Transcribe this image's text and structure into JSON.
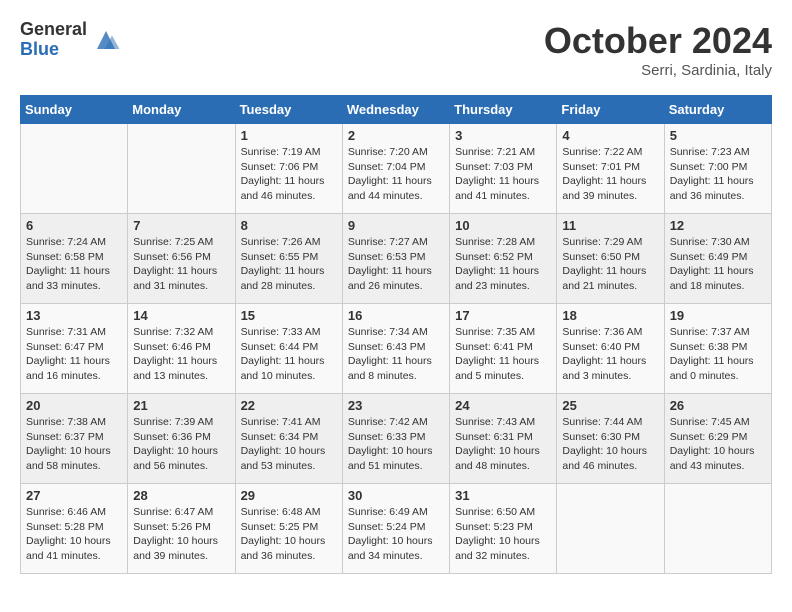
{
  "header": {
    "logo_general": "General",
    "logo_blue": "Blue",
    "month_title": "October 2024",
    "subtitle": "Serri, Sardinia, Italy"
  },
  "days_of_week": [
    "Sunday",
    "Monday",
    "Tuesday",
    "Wednesday",
    "Thursday",
    "Friday",
    "Saturday"
  ],
  "weeks": [
    [
      {
        "day": "",
        "info": ""
      },
      {
        "day": "",
        "info": ""
      },
      {
        "day": "1",
        "info": "Sunrise: 7:19 AM\nSunset: 7:06 PM\nDaylight: 11 hours and 46 minutes."
      },
      {
        "day": "2",
        "info": "Sunrise: 7:20 AM\nSunset: 7:04 PM\nDaylight: 11 hours and 44 minutes."
      },
      {
        "day": "3",
        "info": "Sunrise: 7:21 AM\nSunset: 7:03 PM\nDaylight: 11 hours and 41 minutes."
      },
      {
        "day": "4",
        "info": "Sunrise: 7:22 AM\nSunset: 7:01 PM\nDaylight: 11 hours and 39 minutes."
      },
      {
        "day": "5",
        "info": "Sunrise: 7:23 AM\nSunset: 7:00 PM\nDaylight: 11 hours and 36 minutes."
      }
    ],
    [
      {
        "day": "6",
        "info": "Sunrise: 7:24 AM\nSunset: 6:58 PM\nDaylight: 11 hours and 33 minutes."
      },
      {
        "day": "7",
        "info": "Sunrise: 7:25 AM\nSunset: 6:56 PM\nDaylight: 11 hours and 31 minutes."
      },
      {
        "day": "8",
        "info": "Sunrise: 7:26 AM\nSunset: 6:55 PM\nDaylight: 11 hours and 28 minutes."
      },
      {
        "day": "9",
        "info": "Sunrise: 7:27 AM\nSunset: 6:53 PM\nDaylight: 11 hours and 26 minutes."
      },
      {
        "day": "10",
        "info": "Sunrise: 7:28 AM\nSunset: 6:52 PM\nDaylight: 11 hours and 23 minutes."
      },
      {
        "day": "11",
        "info": "Sunrise: 7:29 AM\nSunset: 6:50 PM\nDaylight: 11 hours and 21 minutes."
      },
      {
        "day": "12",
        "info": "Sunrise: 7:30 AM\nSunset: 6:49 PM\nDaylight: 11 hours and 18 minutes."
      }
    ],
    [
      {
        "day": "13",
        "info": "Sunrise: 7:31 AM\nSunset: 6:47 PM\nDaylight: 11 hours and 16 minutes."
      },
      {
        "day": "14",
        "info": "Sunrise: 7:32 AM\nSunset: 6:46 PM\nDaylight: 11 hours and 13 minutes."
      },
      {
        "day": "15",
        "info": "Sunrise: 7:33 AM\nSunset: 6:44 PM\nDaylight: 11 hours and 10 minutes."
      },
      {
        "day": "16",
        "info": "Sunrise: 7:34 AM\nSunset: 6:43 PM\nDaylight: 11 hours and 8 minutes."
      },
      {
        "day": "17",
        "info": "Sunrise: 7:35 AM\nSunset: 6:41 PM\nDaylight: 11 hours and 5 minutes."
      },
      {
        "day": "18",
        "info": "Sunrise: 7:36 AM\nSunset: 6:40 PM\nDaylight: 11 hours and 3 minutes."
      },
      {
        "day": "19",
        "info": "Sunrise: 7:37 AM\nSunset: 6:38 PM\nDaylight: 11 hours and 0 minutes."
      }
    ],
    [
      {
        "day": "20",
        "info": "Sunrise: 7:38 AM\nSunset: 6:37 PM\nDaylight: 10 hours and 58 minutes."
      },
      {
        "day": "21",
        "info": "Sunrise: 7:39 AM\nSunset: 6:36 PM\nDaylight: 10 hours and 56 minutes."
      },
      {
        "day": "22",
        "info": "Sunrise: 7:41 AM\nSunset: 6:34 PM\nDaylight: 10 hours and 53 minutes."
      },
      {
        "day": "23",
        "info": "Sunrise: 7:42 AM\nSunset: 6:33 PM\nDaylight: 10 hours and 51 minutes."
      },
      {
        "day": "24",
        "info": "Sunrise: 7:43 AM\nSunset: 6:31 PM\nDaylight: 10 hours and 48 minutes."
      },
      {
        "day": "25",
        "info": "Sunrise: 7:44 AM\nSunset: 6:30 PM\nDaylight: 10 hours and 46 minutes."
      },
      {
        "day": "26",
        "info": "Sunrise: 7:45 AM\nSunset: 6:29 PM\nDaylight: 10 hours and 43 minutes."
      }
    ],
    [
      {
        "day": "27",
        "info": "Sunrise: 6:46 AM\nSunset: 5:28 PM\nDaylight: 10 hours and 41 minutes."
      },
      {
        "day": "28",
        "info": "Sunrise: 6:47 AM\nSunset: 5:26 PM\nDaylight: 10 hours and 39 minutes."
      },
      {
        "day": "29",
        "info": "Sunrise: 6:48 AM\nSunset: 5:25 PM\nDaylight: 10 hours and 36 minutes."
      },
      {
        "day": "30",
        "info": "Sunrise: 6:49 AM\nSunset: 5:24 PM\nDaylight: 10 hours and 34 minutes."
      },
      {
        "day": "31",
        "info": "Sunrise: 6:50 AM\nSunset: 5:23 PM\nDaylight: 10 hours and 32 minutes."
      },
      {
        "day": "",
        "info": ""
      },
      {
        "day": "",
        "info": ""
      }
    ]
  ]
}
